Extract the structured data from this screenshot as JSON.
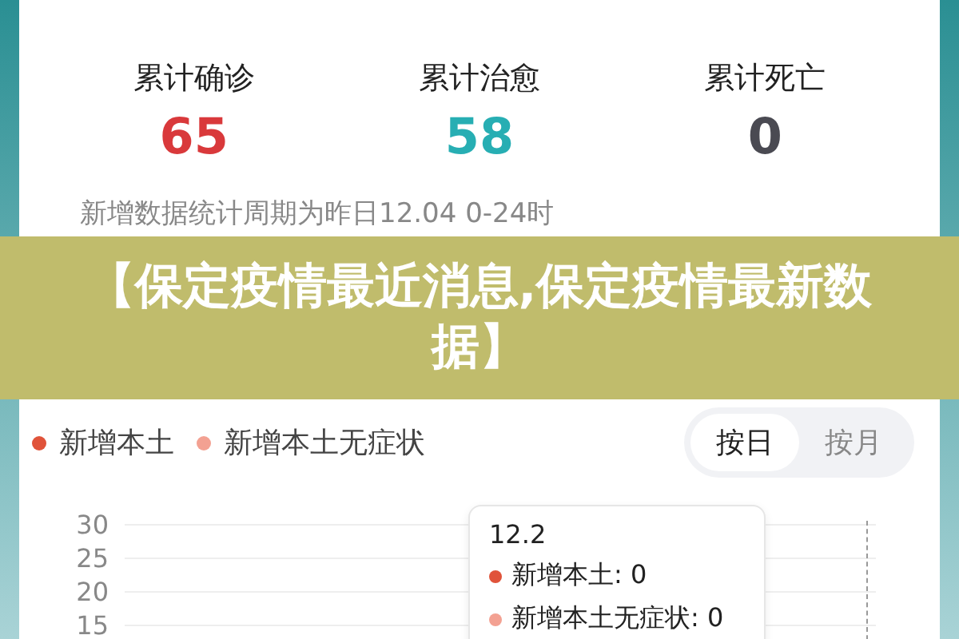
{
  "headline": "【保定疫情最近消息,保定疫情最新数据】",
  "totals": [
    {
      "label": "累计确诊",
      "value": "65",
      "color": "#d9393b"
    },
    {
      "label": "累计治愈",
      "value": "58",
      "color": "#27aeb3"
    },
    {
      "label": "累计死亡",
      "value": "0",
      "color": "#4a4a52"
    }
  ],
  "period_note": "新增数据统计周期为昨日12.04 0-24时",
  "legend": [
    {
      "label": "新增本土",
      "color": "#e0533a"
    },
    {
      "label": "新增本土无症状",
      "color": "#f3a192"
    }
  ],
  "segments": [
    {
      "label": "按日",
      "selected": true
    },
    {
      "label": "按月",
      "selected": false
    }
  ],
  "chart": {
    "yticks": [
      "30",
      "25",
      "20",
      "15"
    ]
  },
  "tooltip": {
    "title": "12.2",
    "rows": [
      {
        "text": "新增本土: 0",
        "color": "#e0533a"
      },
      {
        "text": "新增本土无症状: 0",
        "color": "#f3a192"
      }
    ]
  }
}
